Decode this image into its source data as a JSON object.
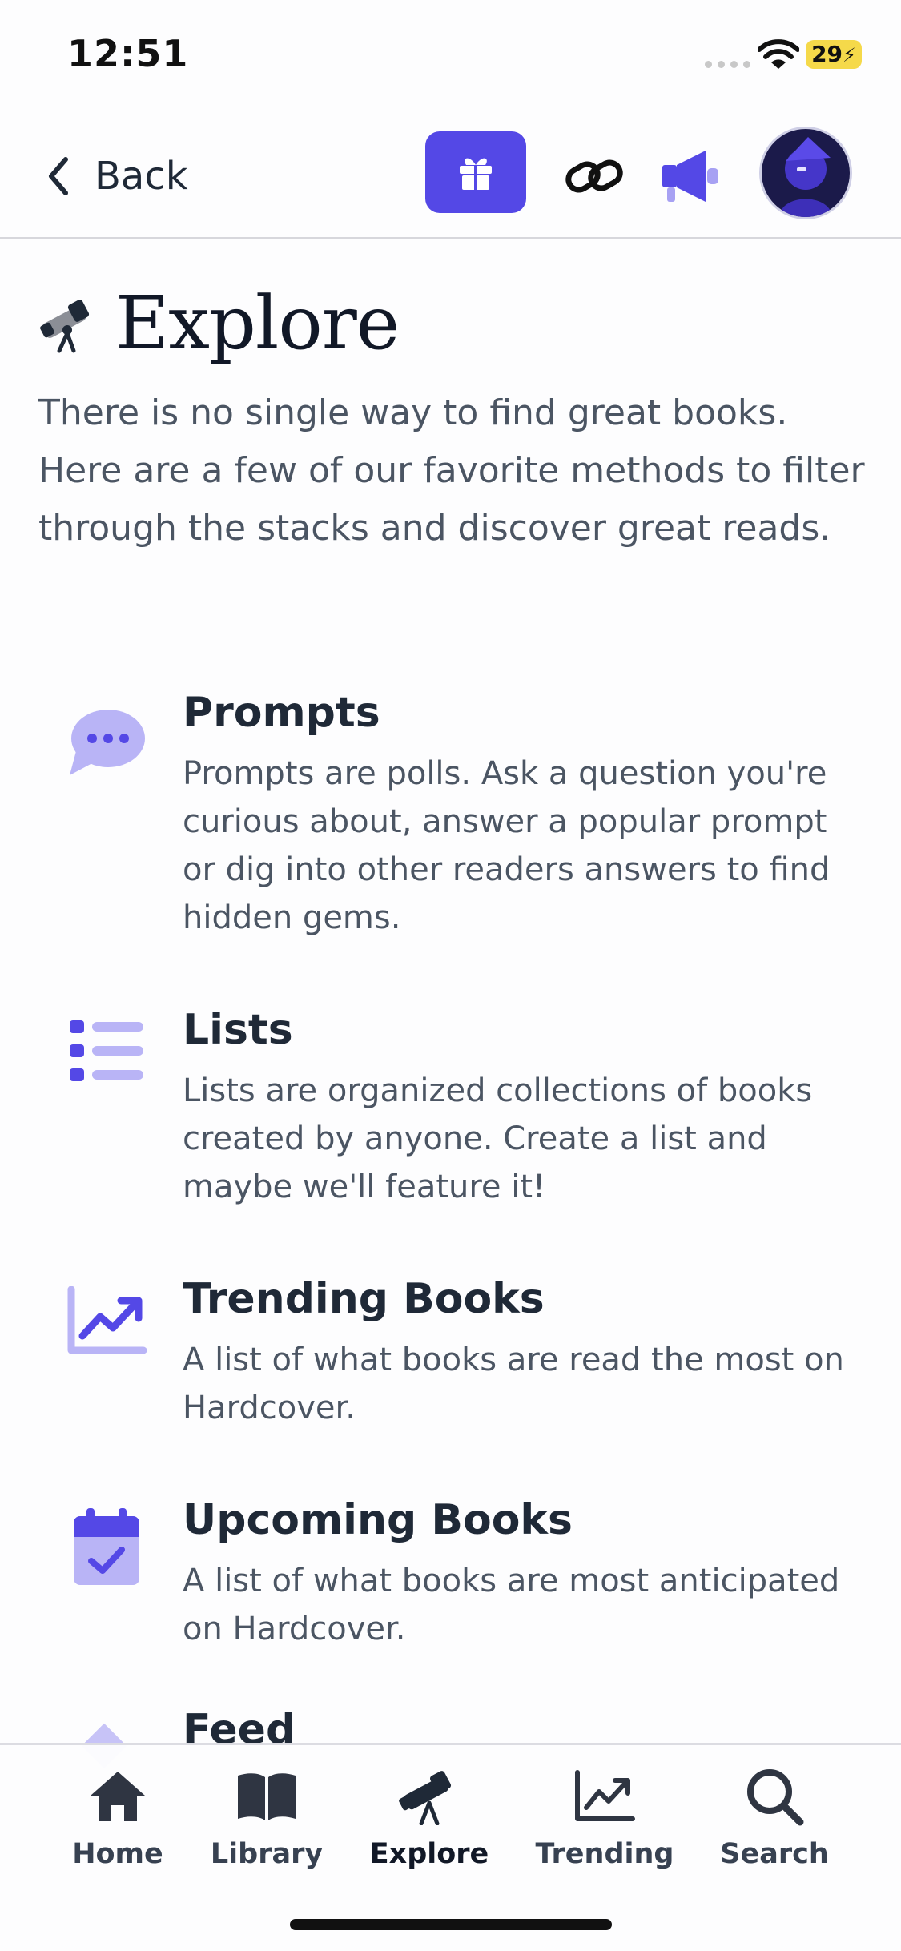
{
  "status_bar": {
    "time": "12:51",
    "battery": "29"
  },
  "nav": {
    "back_label": "Back",
    "actions": [
      {
        "name": "gift",
        "icon": "gift-icon"
      },
      {
        "name": "link",
        "icon": "link-icon"
      },
      {
        "name": "announcements",
        "icon": "megaphone-icon"
      },
      {
        "name": "profile",
        "icon": "avatar"
      }
    ]
  },
  "header": {
    "icon": "telescope-icon",
    "title": "Explore",
    "intro": "There is no single way to find great books. Here are a few of our favorite methods to filter through the stacks and discover great reads."
  },
  "features": [
    {
      "icon": "chat-bubble-icon",
      "title": "Prompts",
      "description": "Prompts are polls. Ask a question you're curious about, answer a popular prompt or dig into other readers answers to find hidden gems."
    },
    {
      "icon": "list-icon",
      "title": "Lists",
      "description": "Lists are organized collections of books created by anyone. Create a list and maybe we'll feature it!"
    },
    {
      "icon": "trending-chart-icon",
      "title": "Trending Books",
      "description": "A list of what books are read the most on Hardcover."
    },
    {
      "icon": "calendar-check-icon",
      "title": "Upcoming Books",
      "description": "A list of what books are most anticipated on Hardcover."
    },
    {
      "icon": "feed-icon",
      "title": "Feed"
    }
  ],
  "tabs": [
    {
      "label": "Home",
      "icon": "home-icon"
    },
    {
      "label": "Library",
      "icon": "book-icon"
    },
    {
      "label": "Explore",
      "icon": "telescope-icon",
      "active": true
    },
    {
      "label": "Trending",
      "icon": "trending-chart-icon"
    },
    {
      "label": "Search",
      "icon": "search-icon"
    }
  ],
  "colors": {
    "accent": "#5448e6",
    "accent_light": "#b9b4f6",
    "text_primary": "#1f2937",
    "text_secondary": "#4b5563"
  }
}
